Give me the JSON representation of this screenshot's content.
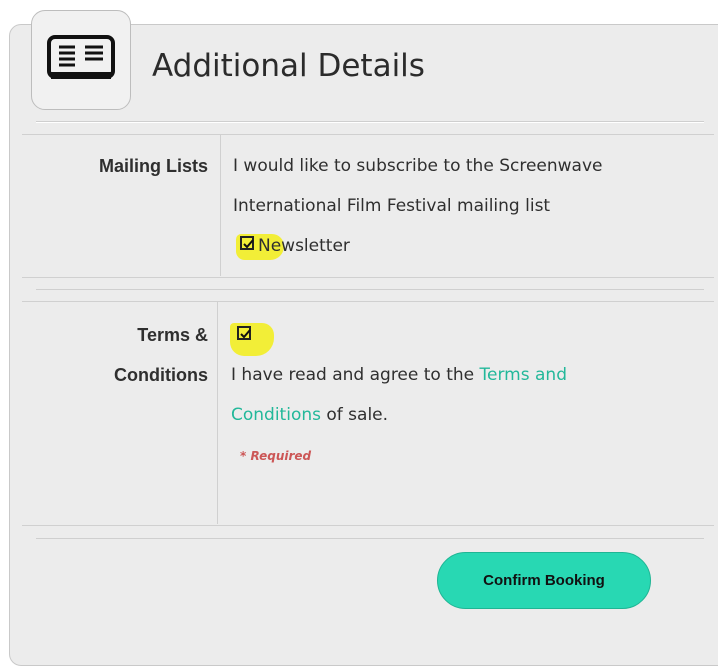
{
  "section": {
    "title": "Additional Details",
    "icon": "newspaper-icon"
  },
  "mailing": {
    "label": "Mailing Lists",
    "description_line1": "I would like to subscribe to the Screenwave",
    "description_line2": "International Film Festival mailing list",
    "option_label": "Newsletter",
    "checked": true
  },
  "terms": {
    "label_line1": "Terms &",
    "label_line2": "Conditions",
    "text_before_link": "I have read and agree to the ",
    "link_part1": "Terms and",
    "link_part2": "Conditions",
    "text_after_link": " of sale.",
    "required_text": "* Required",
    "checked": true
  },
  "actions": {
    "confirm_label": "Confirm Booking"
  },
  "colors": {
    "accent": "#28d8b3",
    "link": "#22b89a",
    "highlight": "#f2ee2d",
    "required": "#cc5656",
    "panel_bg": "#ececec"
  }
}
